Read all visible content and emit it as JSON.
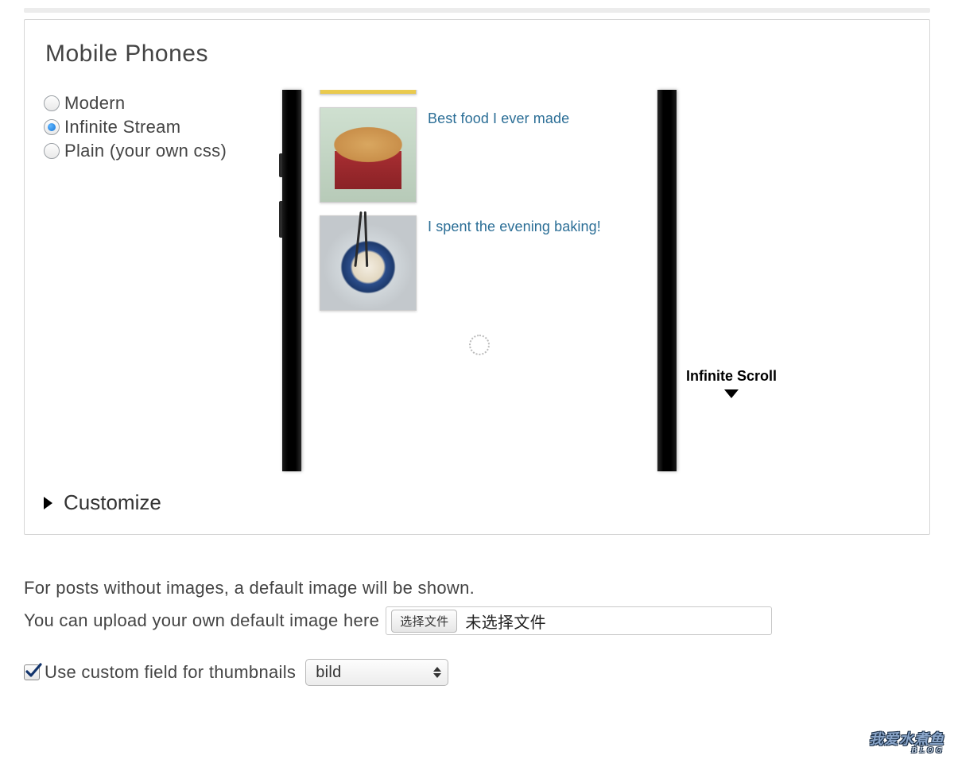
{
  "section": {
    "title": "Mobile Phones",
    "customize_label": "Customize"
  },
  "themes": {
    "options": [
      {
        "label": "Modern",
        "selected": false
      },
      {
        "label": "Infinite Stream",
        "selected": true
      },
      {
        "label": "Plain (your own css)",
        "selected": false
      }
    ]
  },
  "preview": {
    "posts": [
      {
        "title": ""
      },
      {
        "title": "Best food I ever made"
      },
      {
        "title": "I spent the evening baking!"
      }
    ],
    "side_label": "Infinite Scroll"
  },
  "default_image": {
    "line1": "For posts without images, a default image will be shown.",
    "line2_prefix": "You can upload your own default image here",
    "choose_button": "选择文件",
    "no_file_text": "未选择文件"
  },
  "custom_field": {
    "checkbox_label": "Use custom field for thumbnails",
    "checked": true,
    "select_value": "bild"
  },
  "watermark": {
    "line1": "我爱水煮鱼",
    "line2": "BLOG"
  }
}
